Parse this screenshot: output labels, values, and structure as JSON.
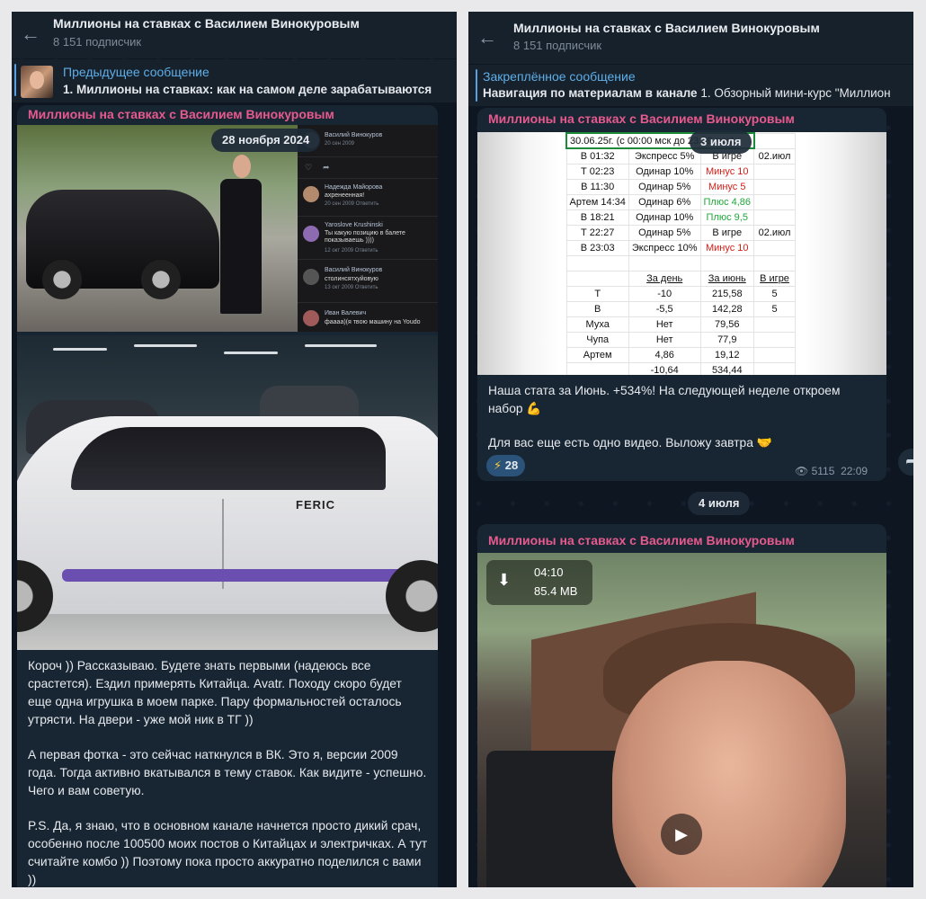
{
  "left": {
    "channel_title": "Миллионы на ставках с Василием Винокуровым",
    "subscribers": "8 151 подписчик",
    "pinned_label": "Предыдущее сообщение",
    "pinned_text": "1. Миллионы на ставках: как на самом деле зарабатываются",
    "message": {
      "sender": "Миллионы на ставках с Василием Винокуровым",
      "date": "28 ноября 2024",
      "vk_comments": [
        {
          "name": "Василий Винокуров",
          "text": "",
          "meta": "20 сен 2009"
        },
        {
          "name": "Надежда Майорова",
          "text": "ахренеенная!",
          "meta": "20 сен 2009 Ответить"
        },
        {
          "name": "Yaroslove Krushinski",
          "text": "Ты какую позицию в балете показываешь ))))",
          "meta": "12 окт 2009 Ответить"
        },
        {
          "name": "Василий Винокуров",
          "text": "столинсятхуйовую",
          "meta": "13 окт 2009 Ответить"
        },
        {
          "name": "Иван Валевич",
          "text": "фаааа)(я твою машину на Youdo",
          "meta": ""
        }
      ],
      "car_badge": "FERIC",
      "paragraphs": [
        "Короч )) Рассказываю. Будете знать первыми (надеюсь все срастется). Ездил примерять Китайца. Avatr. Походу скоро будет еще одна игрушка в моем парке. Пару формальностей осталось утрясти. На двери - уже мой ник в ТГ ))",
        "А первая фотка - это сейчас наткнулся в ВК. Это я, версии 2009 года. Тогда активно вкатывался в тему ставок. Как видите - успешно. Чего и вам советую.",
        "P.S. Да, я знаю, что в основном канале начнется просто дикий срач, особенно после 100500 моих постов о Китайцах и электричках. А тут считайте комбо )) Поэтому пока просто аккуратно поделился с вами ))"
      ]
    }
  },
  "right": {
    "channel_title": "Миллионы на ставках с Василием Винокуровым",
    "subscribers": "8 151 подписчик",
    "pinned_label": "Закреплённое сообщение",
    "pinned_text_bold": "Навигация по материалам в канале",
    "pinned_text_rest": "1. Обзорный мини-курс \"Миллион",
    "message1": {
      "sender": "Миллионы на ставках с Василием Винокуровым",
      "date": "3 июля",
      "table_header": "30.06.25г. (с 00:00 мск до 23:59 мск)",
      "bets": [
        {
          "who": "В 01:32",
          "type": "Экспресс 5%",
          "res": "В игре",
          "res_color": "",
          "extra": "02.июл"
        },
        {
          "who": "Т 02:23",
          "type": "Одинар 10%",
          "res": "Минус 10",
          "res_color": "red",
          "extra": ""
        },
        {
          "who": "В 11:30",
          "type": "Одинар 5%",
          "res": "Минус 5",
          "res_color": "red",
          "extra": ""
        },
        {
          "who": "Артем 14:34",
          "type": "Одинар 6%",
          "res": "Плюс 4,86",
          "res_color": "green",
          "extra": ""
        },
        {
          "who": "В 18:21",
          "type": "Одинар 10%",
          "res": "Плюс 9,5",
          "res_color": "green",
          "extra": ""
        },
        {
          "who": "Т 22:27",
          "type": "Одинар 5%",
          "res": "В игре",
          "res_color": "",
          "extra": "02.июл"
        },
        {
          "who": "В 23:03",
          "type": "Экспресс 10%",
          "res": "Минус 10",
          "res_color": "red",
          "extra": ""
        }
      ],
      "summary_headers": [
        "За день",
        "За июнь",
        "В игре"
      ],
      "summary": [
        {
          "who": "Т",
          "day": "-10",
          "month": "215,58",
          "inplay": "5"
        },
        {
          "who": "В",
          "day": "-5,5",
          "month": "142,28",
          "inplay": "5"
        },
        {
          "who": "Муха",
          "day": "Нет",
          "month": "79,56",
          "inplay": ""
        },
        {
          "who": "Чупа",
          "day": "Нет",
          "month": "77,9",
          "inplay": ""
        },
        {
          "who": "Артем",
          "day": "4,86",
          "month": "19,12",
          "inplay": ""
        },
        {
          "who": "",
          "day": "-10,64",
          "month": "534,44",
          "inplay": ""
        }
      ],
      "text1": "Наша стата за Июнь. +534%! На следующей неделе откроем набор 💪",
      "text2": "Для вас еще есть одно видео. Выложу завтра 🤝",
      "reaction_icon": "⚡",
      "reaction_count": "28",
      "views": "5115",
      "time": "22:09"
    },
    "message2": {
      "sender": "Миллионы на ставках с Василием Винокуровым",
      "date": "4 июля",
      "video_duration": "04:10",
      "video_size": "85.4 MB"
    }
  },
  "colors": {
    "background": "#0e1621",
    "header": "#17212b",
    "bubble": "#182533",
    "sender": "#e65a8e",
    "accent": "#5eaee9"
  }
}
